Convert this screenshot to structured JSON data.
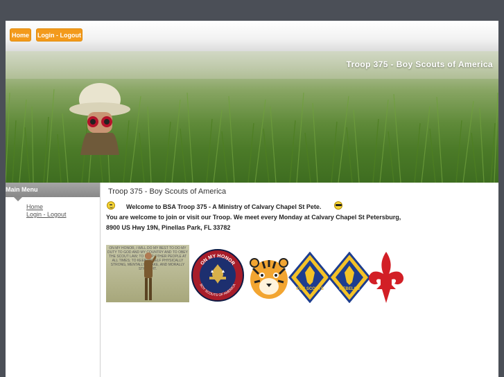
{
  "nav": {
    "home_label": "Home",
    "login_label": "Login - Logout"
  },
  "banner": {
    "title": "Troop 375 - Boy Scouts of America"
  },
  "sidebar": {
    "heading": "Main Menu",
    "items": [
      {
        "label": "Home"
      },
      {
        "label": "Login - Logout"
      }
    ]
  },
  "content": {
    "title": "Troop 375 - Boy Scouts of America",
    "welcome": "Welcome to BSA Troop 375 - A Ministry of Calvary Chapel St Pete.",
    "line2": "You are welcome to join or visit our Troop.  We meet every Monday at Calvary Chapel St Petersburg,",
    "line3": "8900 US Hwy 19N, Pinellas Park, FL 33782",
    "honor_image_text": "ON MY HONOR, I WILL DO MY BEST TO DO MY DUTY TO GOD AND MY COUNTRY AND TO OBEY THE SCOUT LAW; TO HELP OTHER PEOPLE AT ALL TIMES; TO KEEP MYSELF PHYSICALLY STRONG, MENTALLY AWAKE, AND MORALLY STRAIGHT.",
    "seal_text_top": "ON MY HONOR",
    "seal_text_bottom": "BOY SCOUTS OF AMERICA",
    "cub_scouts_label": "CUB SCOUTS",
    "webelos_label": "WEBELOS"
  },
  "colors": {
    "nav_button": "#f39a1c",
    "sidebar_head": "#999999",
    "page_bg": "#4b4f57"
  }
}
